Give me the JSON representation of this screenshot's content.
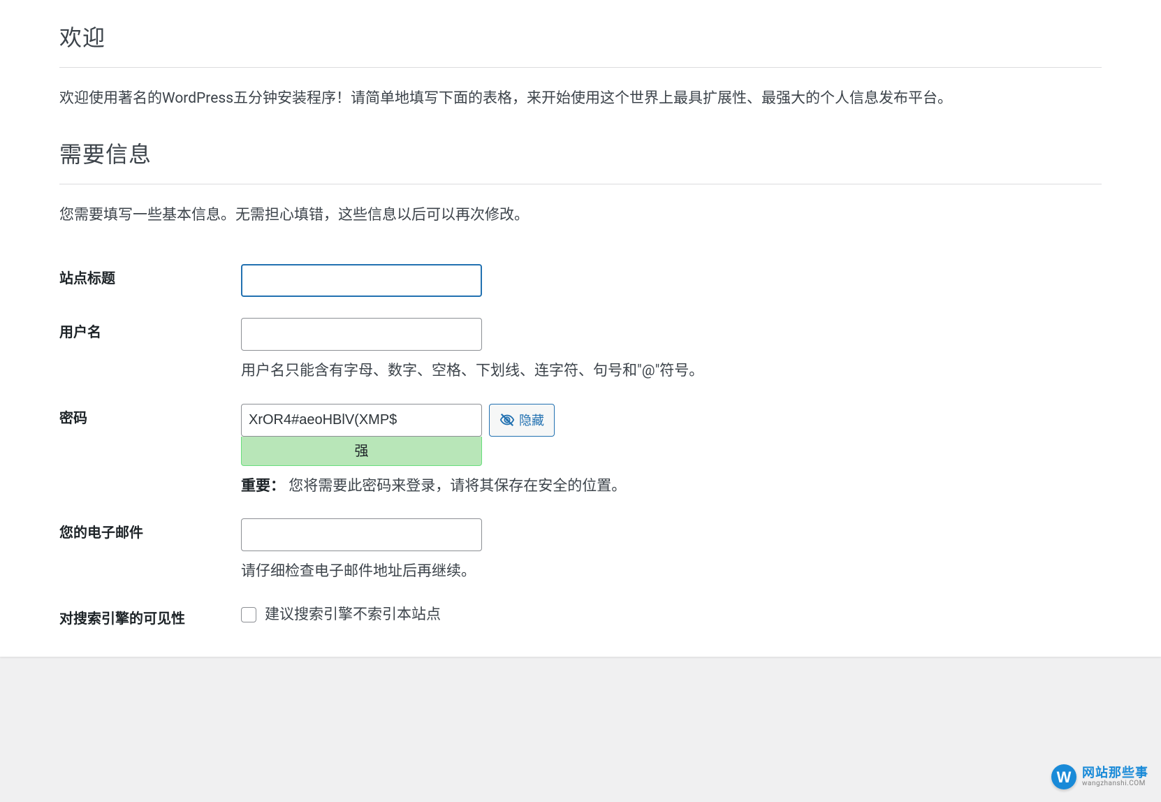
{
  "headings": {
    "welcome": "欢迎",
    "info_needed": "需要信息"
  },
  "paragraphs": {
    "welcome_intro": "欢迎使用著名的WordPress五分钟安装程序！请简单地填写下面的表格，来开始使用这个世界上最具扩展性、最强大的个人信息发布平台。",
    "info_intro": "您需要填写一些基本信息。无需担心填错，这些信息以后可以再次修改。"
  },
  "form": {
    "site_title": {
      "label": "站点标题",
      "value": ""
    },
    "username": {
      "label": "用户名",
      "value": "",
      "description": "用户名只能含有字母、数字、空格、下划线、连字符、句号和\"@\"符号。"
    },
    "password": {
      "label": "密码",
      "value": "XrOR4#aeoHBlV(XMP$",
      "hide_button": "隐藏",
      "strength": "强",
      "important_label": "重要：",
      "important_text": "您将需要此密码来登录，请将其保存在安全的位置。"
    },
    "email": {
      "label": "您的电子邮件",
      "value": "",
      "description": "请仔细检查电子邮件地址后再继续。"
    },
    "visibility": {
      "label": "对搜索引擎的可见性",
      "checkbox_label": "建议搜索引擎不索引本站点"
    }
  },
  "watermark": {
    "logo_char": "W",
    "cn": "网站那些事",
    "en": "wangzhanshi.COM"
  }
}
